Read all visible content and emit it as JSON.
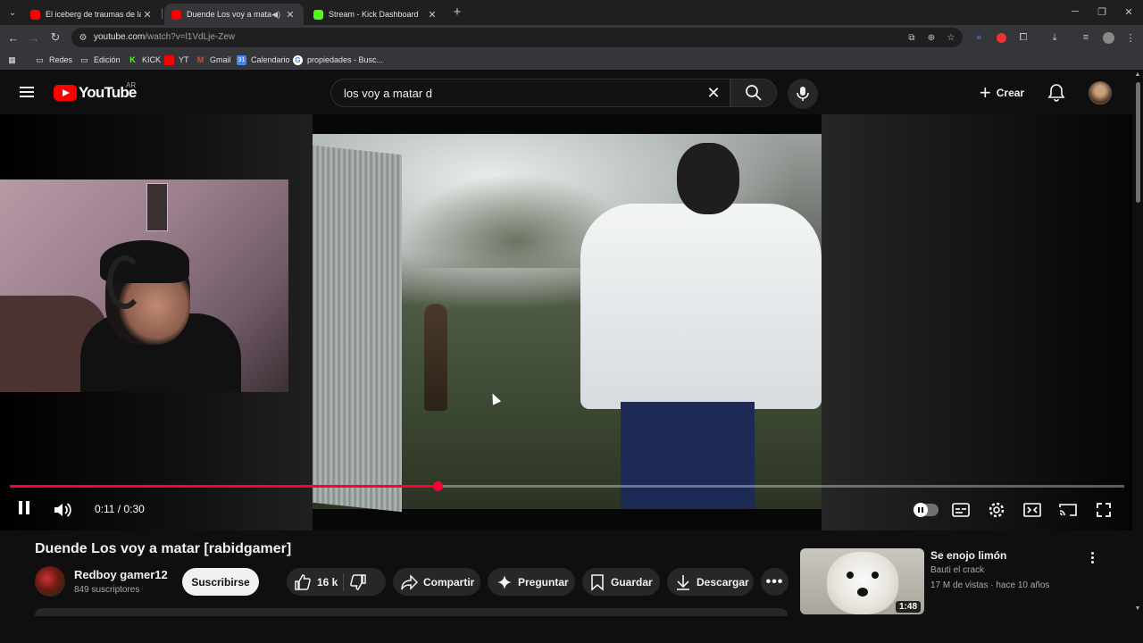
{
  "browser": {
    "tabs": [
      {
        "title": "El iceberg de traumas de la infa",
        "active": false,
        "favicon_color": "#ff0000"
      },
      {
        "title": "Duende Los voy a matar [ra",
        "active": true,
        "favicon_color": "#ff0000"
      },
      {
        "title": "Stream - Kick Dashboard",
        "active": false,
        "favicon_color": "#53fc18"
      }
    ],
    "url_host": "youtube.com",
    "url_path": "/watch?v=l1VdLje-Zew",
    "bookmarks": [
      {
        "label": "Redes",
        "icon": "folder-icon"
      },
      {
        "label": "Edición",
        "icon": "folder-icon"
      },
      {
        "label": "KICK",
        "icon": "kick-icon"
      },
      {
        "label": "YT",
        "icon": "youtube-icon"
      },
      {
        "label": "Gmail",
        "icon": "gmail-icon"
      },
      {
        "label": "Calendario",
        "icon": "calendar-icon"
      },
      {
        "label": "propiedades - Busc...",
        "icon": "google-icon"
      }
    ]
  },
  "youtube": {
    "logo_text": "YouTube",
    "country": "AR",
    "search_value": "los voy a matar d",
    "create_label": "Crear"
  },
  "player": {
    "time_label": "0:11 / 0:30",
    "progress": 0.384,
    "state": "playing"
  },
  "video": {
    "title": "Duende Los voy a matar [rabidgamer]",
    "channel": "Redboy gamer12",
    "subscribers": "849 suscriptores",
    "subscribe_label": "Suscribirse",
    "likes": "16 k",
    "share_label": "Compartir",
    "ask_label": "Preguntar",
    "save_label": "Guardar",
    "download_label": "Descargar"
  },
  "recommendation": {
    "title": "Se enojo limón",
    "channel": "Bauti el crack",
    "meta": "17 M de vistas · hace 10 años",
    "duration": "1:48"
  },
  "colors": {
    "accent": "#ff0033",
    "background": "#0f0f0f",
    "pill": "#272727"
  }
}
